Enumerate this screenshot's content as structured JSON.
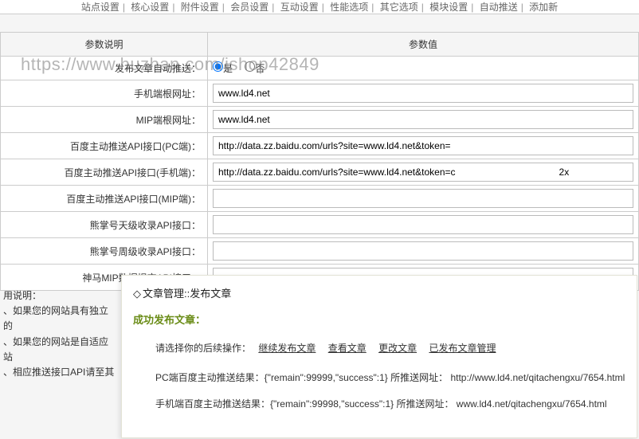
{
  "nav": {
    "items": [
      "站点设置",
      "核心设置",
      "附件设置",
      "会员设置",
      "互动设置",
      "性能选项",
      "其它选项",
      "模块设置",
      "自动推送",
      "添加新"
    ]
  },
  "table": {
    "header_label": "参数说明",
    "header_value": "参数值",
    "rows": [
      {
        "label": "发布文章自动推送：",
        "type": "radio",
        "yes": "是",
        "no": "否"
      },
      {
        "label": "手机端根网址：",
        "type": "text",
        "value": "www.ld4.net"
      },
      {
        "label": "MIP端根网址：",
        "type": "text",
        "value": "www.ld4.net"
      },
      {
        "label": "百度主动推送API接口(PC端)：",
        "type": "text",
        "value": "http://data.zz.baidu.com/urls?site=www.ld4.net&token="
      },
      {
        "label": "百度主动推送API接口(手机端)：",
        "type": "text",
        "value": "http://data.zz.baidu.com/urls?site=www.ld4.net&token=c                                       2x"
      },
      {
        "label": "百度主动推送API接口(MIP端)：",
        "type": "text",
        "value": ""
      },
      {
        "label": "熊掌号天级收录API接口：",
        "type": "text",
        "value": ""
      },
      {
        "label": "熊掌号周级收录API接口：",
        "type": "text",
        "value": ""
      },
      {
        "label": "神马MIP数据提交API接口：",
        "type": "text",
        "value": ""
      }
    ]
  },
  "usage": {
    "title": "用说明：",
    "lines": [
      "、如果您的网站具有独立的",
      "、如果您的网站是自适应站",
      "、相应推送接口API请至其"
    ]
  },
  "panel": {
    "title_prefix": "◇",
    "title": "文章管理::发布文章",
    "success": "成功发布文章：",
    "ops_prompt": "请选择你的后续操作：",
    "ops": [
      "继续发布文章",
      "查看文章",
      "更改文章",
      "已发布文章管理"
    ],
    "result_pc": "PC端百度主动推送结果：{\"remain\":99999,\"success\":1} 所推送网址： http://www.ld4.net/qitachengxu/7654.html",
    "result_mobile": "手机端百度主动推送结果：{\"remain\":99998,\"success\":1} 所推送网址： www.ld4.net/qitachengxu/7654.html"
  },
  "watermark": "https://www.huzhan.com/ishop42849"
}
